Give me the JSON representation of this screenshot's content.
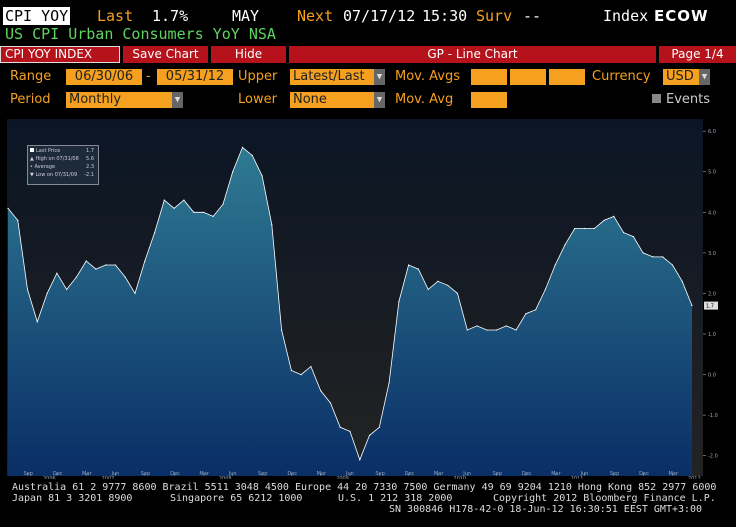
{
  "header": {
    "ticker": "CPI YOY",
    "last_label": "Last",
    "last_value": "1.7%",
    "month": "MAY",
    "next_label": "Next",
    "next_date": "07/17/12",
    "next_time": "15:30",
    "surv_label": "Surv",
    "surv_value": "--",
    "index_label": "Index",
    "ecow": "ECOW",
    "description": "US CPI Urban Consumers YoY NSA"
  },
  "toolbar": {
    "index_tab": "CPI YOY INDEX",
    "save_chart": "Save Chart",
    "hide": "Hide",
    "title": "GP - Line Chart",
    "page": "Page 1/4"
  },
  "controls": {
    "range_label": "Range",
    "range_start": "06/30/06",
    "range_sep": "-",
    "range_end": "05/31/12",
    "upper_label": "Upper",
    "upper_value": "Latest/Last",
    "mov_avgs_label": "Mov. Avgs",
    "currency_label": "Currency",
    "currency_value": "USD",
    "period_label": "Period",
    "period_value": "Monthly",
    "lower_label": "Lower",
    "lower_value": "None",
    "mov_avg_label": "Mov. Avg",
    "events_label": "Events"
  },
  "legend": {
    "last_price": "Last Price",
    "last_price_val": "1.7",
    "high": "High on 07/31/08",
    "high_val": "5.6",
    "average": "Average",
    "average_val": "2.3",
    "low": "Low on 07/31/09",
    "low_val": "-2.1"
  },
  "chart_data": {
    "type": "area",
    "x": [
      "2006-07",
      "2006-08",
      "2006-09",
      "2006-10",
      "2006-11",
      "2006-12",
      "2007-01",
      "2007-02",
      "2007-03",
      "2007-04",
      "2007-05",
      "2007-06",
      "2007-07",
      "2007-08",
      "2007-09",
      "2007-10",
      "2007-11",
      "2007-12",
      "2008-01",
      "2008-02",
      "2008-03",
      "2008-04",
      "2008-05",
      "2008-06",
      "2008-07",
      "2008-08",
      "2008-09",
      "2008-10",
      "2008-11",
      "2008-12",
      "2009-01",
      "2009-02",
      "2009-03",
      "2009-04",
      "2009-05",
      "2009-06",
      "2009-07",
      "2009-08",
      "2009-09",
      "2009-10",
      "2009-11",
      "2009-12",
      "2010-01",
      "2010-02",
      "2010-03",
      "2010-04",
      "2010-05",
      "2010-06",
      "2010-07",
      "2010-08",
      "2010-09",
      "2010-10",
      "2010-11",
      "2010-12",
      "2011-01",
      "2011-02",
      "2011-03",
      "2011-04",
      "2011-05",
      "2011-06",
      "2011-07",
      "2011-08",
      "2011-09",
      "2011-10",
      "2011-11",
      "2011-12",
      "2012-01",
      "2012-02",
      "2012-03",
      "2012-04",
      "2012-05"
    ],
    "values": [
      4.1,
      3.8,
      2.1,
      1.3,
      2.0,
      2.5,
      2.1,
      2.4,
      2.8,
      2.6,
      2.7,
      2.7,
      2.4,
      2.0,
      2.8,
      3.5,
      4.3,
      4.1,
      4.3,
      4.0,
      4.0,
      3.9,
      4.2,
      5.0,
      5.6,
      5.4,
      4.9,
      3.7,
      1.1,
      0.1,
      0.0,
      0.2,
      -0.4,
      -0.7,
      -1.3,
      -1.4,
      -2.1,
      -1.5,
      -1.3,
      -0.2,
      1.8,
      2.7,
      2.6,
      2.1,
      2.3,
      2.2,
      2.0,
      1.1,
      1.2,
      1.1,
      1.1,
      1.2,
      1.1,
      1.5,
      1.6,
      2.1,
      2.7,
      3.2,
      3.6,
      3.6,
      3.6,
      3.8,
      3.9,
      3.5,
      3.4,
      3.0,
      2.9,
      2.9,
      2.7,
      2.3,
      1.7
    ],
    "ylim": [
      -2.5,
      6.3
    ],
    "yticks": [
      "6.0",
      "5.0",
      "4.0",
      "3.0",
      "2.0",
      "1.0",
      "0.0",
      "-1.0",
      "-2.0"
    ],
    "ytick_values": [
      6,
      5,
      4,
      3,
      2,
      1,
      0,
      -1,
      -2
    ],
    "last_label": "1.7",
    "month_ticks": [
      "Sep",
      "Dec",
      "Mar",
      "Jun",
      "Sep",
      "Dec",
      "Mar",
      "Jun",
      "Sep",
      "Dec",
      "Mar",
      "Jun",
      "Sep",
      "Dec",
      "Mar",
      "Jun",
      "Sep",
      "Dec",
      "Mar",
      "Jun",
      "Sep",
      "Dec",
      "Mar"
    ],
    "month_tick_index": [
      2,
      5,
      8,
      11,
      14,
      17,
      20,
      23,
      26,
      29,
      32,
      35,
      38,
      41,
      44,
      47,
      50,
      53,
      56,
      59,
      62,
      65,
      68
    ],
    "year_ticks": [
      "2006",
      "2007",
      "2008",
      "2009",
      "2010",
      "2011",
      "2012"
    ],
    "year_tick_index": [
      0,
      6,
      18,
      30,
      42,
      54,
      66
    ],
    "grid": false,
    "colors": {
      "fill_top": "#2f7a92",
      "fill_bottom": "#0a2e66",
      "line": "#ffffff",
      "bg_top": "#0b1524",
      "bg_bottom": "#232323"
    }
  },
  "footer": {
    "line1": "Australia 61 2 9777 8600 Brazil 5511 3048 4500 Europe 44 20 7330 7500 Germany 49 69 9204 1210 Hong Kong 852 2977 6000",
    "line2a": "Japan 81 3 3201 8900",
    "line2b": "Singapore 65 6212 1000",
    "line2c": "U.S. 1 212 318 2000",
    "line2d": "Copyright 2012 Bloomberg Finance L.P.",
    "line3": "SN 300846 H178-42-0 18-Jun-12 16:30:51 EEST GMT+3:00"
  }
}
